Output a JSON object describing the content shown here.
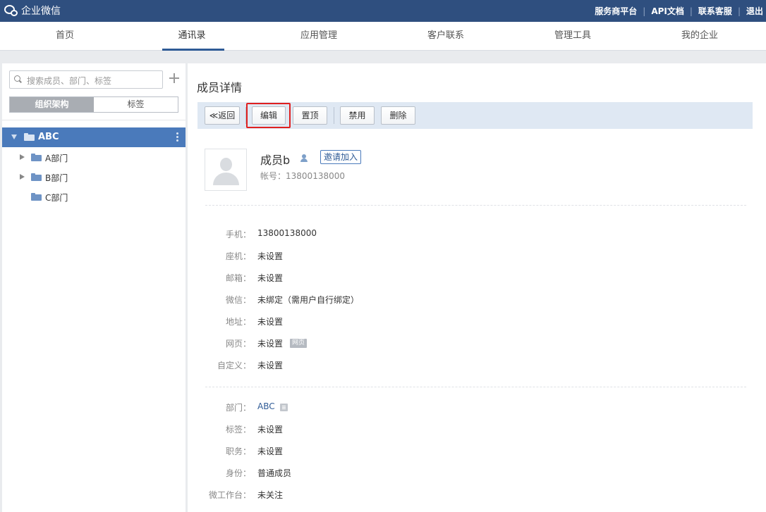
{
  "topbar": {
    "logo_text": "企业微信",
    "links": [
      "服务商平台",
      "API文档",
      "联系客服",
      "退出"
    ]
  },
  "nav": {
    "items": [
      "首页",
      "通讯录",
      "应用管理",
      "客户联系",
      "管理工具",
      "我的企业"
    ],
    "active_index": 1
  },
  "sidebar": {
    "search_placeholder": "搜索成员、部门、标签",
    "segments": [
      "组织架构",
      "标签"
    ],
    "active_segment": 0,
    "tree": {
      "root": "ABC",
      "children": [
        "A部门",
        "B部门",
        "C部门"
      ]
    }
  },
  "main": {
    "title": "成员详情",
    "toolbar": {
      "back": "返回",
      "back_glyph": "≪",
      "edit": "编辑",
      "pin": "置顶",
      "disable": "禁用",
      "delete": "删除"
    },
    "profile": {
      "name": "成员b",
      "invite": "邀请加入",
      "account_label": "帐号：",
      "account": "13800138000"
    },
    "fields": [
      {
        "label": "手机：",
        "value": "13800138000"
      },
      {
        "label": "座机：",
        "value": "未设置"
      },
      {
        "label": "邮箱：",
        "value": "未设置"
      },
      {
        "label": "微信：",
        "value": "未绑定（需用户自行绑定）"
      },
      {
        "label": "地址：",
        "value": "未设置"
      },
      {
        "label": "网页：",
        "value": "未设置",
        "badge": "网页"
      },
      {
        "label": "自定义：",
        "value": "未设置"
      }
    ],
    "org_fields": [
      {
        "label": "部门：",
        "value": "ABC"
      },
      {
        "label": "标签：",
        "value": "未设置"
      },
      {
        "label": "职务：",
        "value": "未设置"
      },
      {
        "label": "身份：",
        "value": "普通成员"
      },
      {
        "label": "微工作台：",
        "value": "未关注"
      }
    ]
  },
  "colors": {
    "topbar": "#2f4f7f",
    "accent": "#4a7abb",
    "highlight": "#e02020"
  }
}
